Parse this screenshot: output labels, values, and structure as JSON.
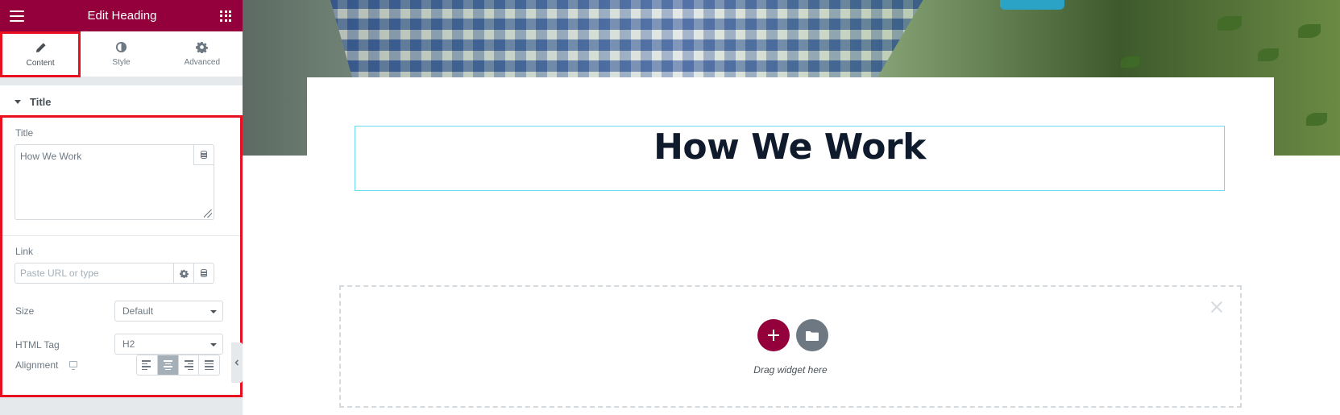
{
  "panel": {
    "header_title": "Edit Heading",
    "tabs": [
      {
        "label": "Content",
        "icon": "pencil-icon",
        "active": true
      },
      {
        "label": "Style",
        "icon": "half-circle-icon",
        "active": false
      },
      {
        "label": "Advanced",
        "icon": "gear-icon",
        "active": false
      }
    ],
    "section_title": "Title",
    "controls": {
      "title_label": "Title",
      "title_value": "How We Work",
      "link_label": "Link",
      "link_placeholder": "Paste URL or type",
      "size_label": "Size",
      "size_value": "Default",
      "html_tag_label": "HTML Tag",
      "html_tag_value": "H2",
      "alignment_label": "Alignment",
      "alignment_options": [
        "left",
        "center",
        "right",
        "justify"
      ],
      "alignment_selected": "center"
    }
  },
  "canvas": {
    "heading_text": "How We Work",
    "drop_text": "Drag widget here"
  },
  "colors": {
    "brand": "#93003c",
    "highlight": "#e8101e",
    "heading": "#0f1b2c",
    "selection_outline": "#71d7f7"
  }
}
